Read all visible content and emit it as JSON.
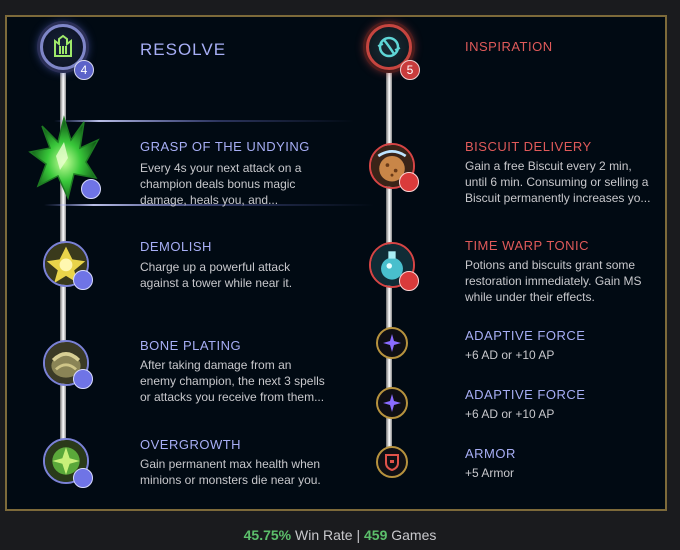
{
  "primary_tree": {
    "title": "RESOLVE",
    "badge": "4",
    "color": "#a7aef5",
    "icon": "resolve-tree-icon"
  },
  "secondary_tree": {
    "title": "INSPIRATION",
    "badge": "5",
    "color": "#e05a5a",
    "icon": "inspiration-tree-icon"
  },
  "primary_runes": [
    {
      "name": "GRASP OF THE UNDYING",
      "desc_lines": [
        "Every 4s your next attack on a",
        "champion deals bonus magic",
        "damage, heals you, and..."
      ],
      "icon": "grasp-of-the-undying-icon"
    },
    {
      "name": "DEMOLISH",
      "desc_lines": [
        "Charge up a powerful attack",
        "against a tower while near it."
      ],
      "icon": "demolish-icon"
    },
    {
      "name": "BONE PLATING",
      "desc_lines": [
        "After taking damage from an",
        "enemy champion, the next 3 spells",
        "or attacks you receive from them..."
      ],
      "icon": "bone-plating-icon"
    },
    {
      "name": "OVERGROWTH",
      "desc_lines": [
        "Gain permanent max health when",
        "minions or monsters die near you."
      ],
      "icon": "overgrowth-icon"
    }
  ],
  "secondary_runes": [
    {
      "name": "BISCUIT DELIVERY",
      "desc_lines": [
        "Gain a free Biscuit every 2 min,",
        "until 6 min. Consuming or selling a",
        "Biscuit permanently increases yo..."
      ],
      "icon": "biscuit-delivery-icon"
    },
    {
      "name": "TIME WARP TONIC",
      "desc_lines": [
        "Potions and biscuits grant some",
        "restoration immediately. Gain MS",
        "while under their effects."
      ],
      "icon": "time-warp-tonic-icon"
    }
  ],
  "shards": [
    {
      "name": "ADAPTIVE FORCE",
      "desc": "+6 AD or +10 AP",
      "icon": "adaptive-force-icon"
    },
    {
      "name": "ADAPTIVE FORCE",
      "desc": "+6 AD or +10 AP",
      "icon": "adaptive-force-icon"
    },
    {
      "name": "ARMOR",
      "desc": "+5 Armor",
      "icon": "armor-icon"
    }
  ],
  "footer": {
    "win_rate": "45.75%",
    "win_rate_label": "Win Rate",
    "separator": "|",
    "games": "459",
    "games_label": "Games"
  }
}
